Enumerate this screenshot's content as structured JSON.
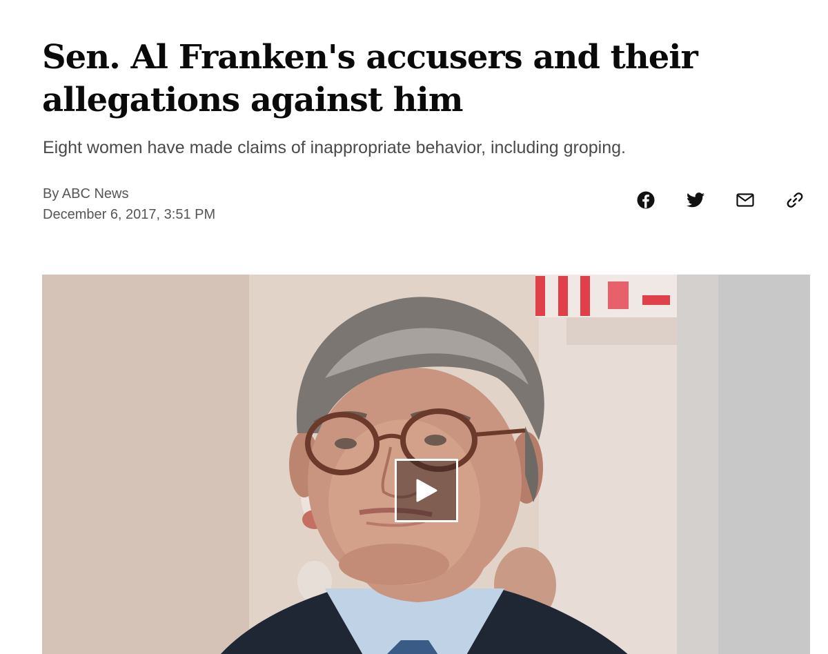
{
  "article": {
    "headline": "Sen. Al Franken's accusers and their allegations against him",
    "subheadline": "Eight women have made claims of inappropriate behavior, including groping.",
    "byline": "By ABC News",
    "timestamp": "December 6, 2017, 3:51 PM"
  },
  "share": {
    "icons": [
      "facebook-icon",
      "twitter-icon",
      "email-icon",
      "link-icon"
    ]
  },
  "media": {
    "type": "video",
    "play_icon": "play-icon"
  }
}
